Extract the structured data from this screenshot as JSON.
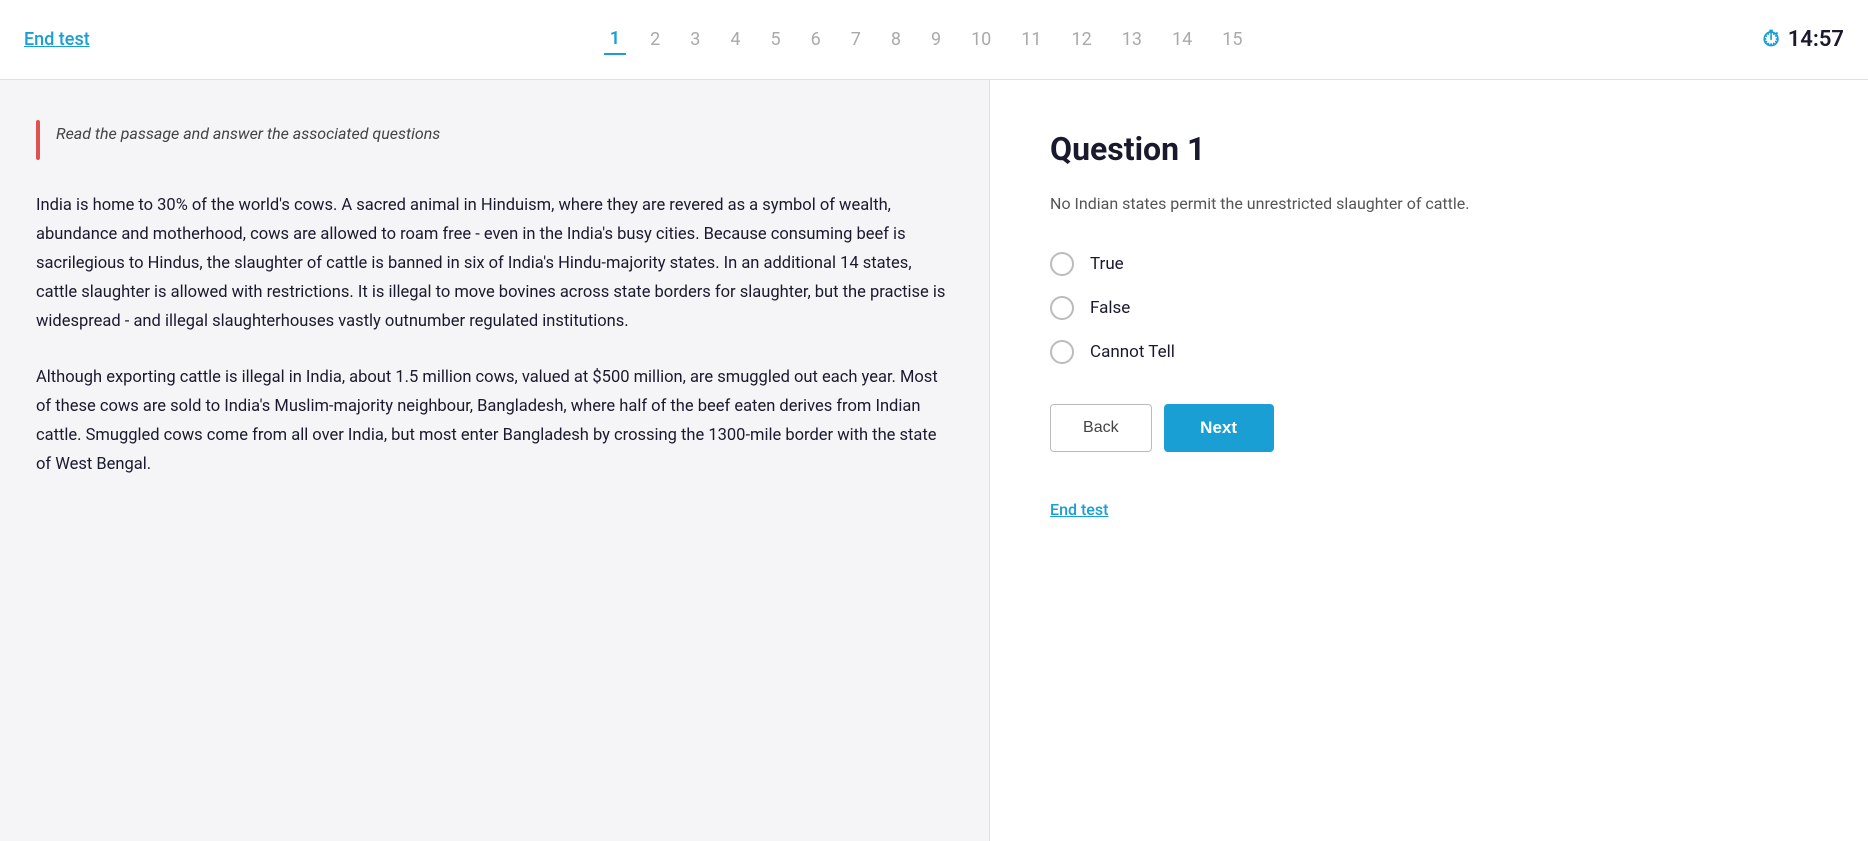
{
  "topbar": {
    "end_test_label": "End test",
    "timer": "14:57",
    "question_numbers": [
      1,
      2,
      3,
      4,
      5,
      6,
      7,
      8,
      9,
      10,
      11,
      12,
      13,
      14,
      15
    ],
    "active_question": 1
  },
  "icons": {
    "timer_icon": "⏱"
  },
  "passage": {
    "instruction": "Read the passage and answer the associated questions",
    "paragraph1": "India is home to 30% of the world's cows. A sacred animal in Hinduism, where they are revered as a symbol of wealth, abundance and motherhood, cows are allowed to roam free - even in the India's busy cities. Because consuming beef is sacrilegious to Hindus, the slaughter of cattle is banned in six of India's Hindu-majority states. In an additional 14 states, cattle slaughter is allowed with restrictions. It is illegal to move bovines across state borders for slaughter, but the practise is widespread - and illegal slaughterhouses vastly outnumber regulated institutions.",
    "paragraph2": "Although exporting cattle is illegal in India, about 1.5 million cows, valued at $500 million, are smuggled out each year. Most of these cows are sold to India's Muslim-majority neighbour, Bangladesh, where half of the beef eaten derives from Indian cattle. Smuggled cows come from all over India, but most enter Bangladesh by crossing the 1300-mile border with the state of West Bengal."
  },
  "question": {
    "title": "Question 1",
    "body": "No Indian states permit the unrestricted slaughter of cattle.",
    "options": [
      {
        "id": "true",
        "label": "True"
      },
      {
        "id": "false",
        "label": "False"
      },
      {
        "id": "cannot-tell",
        "label": "Cannot Tell"
      }
    ],
    "back_label": "Back",
    "next_label": "Next",
    "end_test_label": "End test"
  }
}
